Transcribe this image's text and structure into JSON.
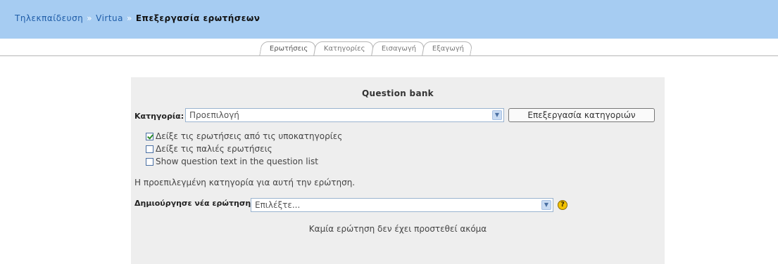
{
  "breadcrumb": {
    "items": [
      "Τηλεκπαίδευση",
      "Virtua"
    ],
    "separator": "»",
    "current": "Επεξεργασία ερωτήσεων"
  },
  "tabs": [
    "Ερωτήσεις",
    "Κατηγορίες",
    "Εισαγωγή",
    "Εξαγωγή"
  ],
  "panel": {
    "title": "Question bank",
    "category_label": "Κατηγορία:",
    "category_value": "Προεπιλογή",
    "edit_categories_button": "Επεξεργασία κατηγοριών",
    "options": [
      {
        "label": "Δείξε τις ερωτήσεις από τις υποκατηγορίες",
        "checked": true
      },
      {
        "label": "Δείξε τις παλιές ερωτήσεις",
        "checked": false
      },
      {
        "label": "Show question text in the question list",
        "checked": false
      }
    ],
    "default_category_note": "Η προεπιλεγμένη κατηγορία για αυτή την ερώτηση.",
    "create_label": "Δημιούργησε νέα ερώτηση:",
    "create_value": "Επιλέξτε...",
    "help_icon_text": "?",
    "empty_message": "Καμία ερώτηση δεν έχει προστεθεί ακόμα"
  },
  "colors": {
    "navbar": "#a6ccf2",
    "panel": "#eeeeee",
    "link": "#1f5da8"
  }
}
